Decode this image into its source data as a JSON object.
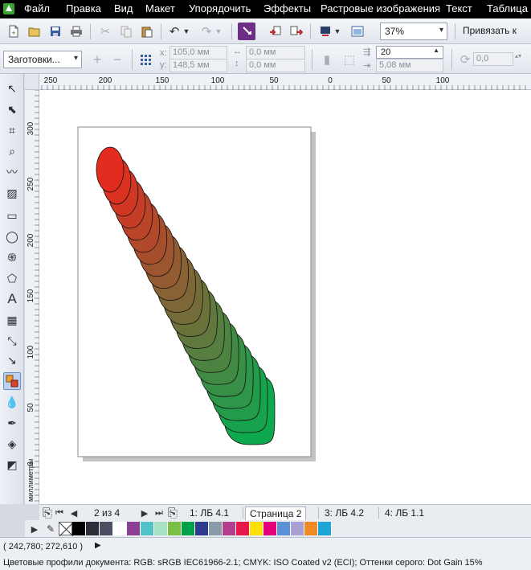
{
  "menu": {
    "items": [
      {
        "label": "Файл",
        "acc": "Ф",
        "rest": "айл"
      },
      {
        "label": "Правка",
        "acc": "П",
        "rest": "равка"
      },
      {
        "label": "Вид",
        "acc": "В",
        "rest": "ид"
      },
      {
        "label": "Макет",
        "acc": "М",
        "rest": "акет"
      },
      {
        "label": "Упорядочить",
        "acc": "У",
        "rest": "порядочить"
      },
      {
        "label": "Эффекты",
        "acc": "Э",
        "rest": "ффекты"
      },
      {
        "label": "Растровые изображения",
        "acc": "Р",
        "rest": "астровые изображения"
      },
      {
        "label": "Текст",
        "acc": "Т",
        "rest": "екст"
      },
      {
        "label": "Таблица",
        "acc": "Т",
        "rest": "аблица"
      }
    ]
  },
  "toolbar": {
    "zoom": "37%",
    "snap_label": "Привязать к"
  },
  "property_bar": {
    "preset": "Заготовки...",
    "x_label": "x:",
    "x_value": "105,0 мм",
    "y_label": "y:",
    "y_value": "148,5 мм",
    "w_value": "0,0 мм",
    "h_value": "0,0 мм",
    "steps": "20",
    "spacing": "5,08 мм",
    "rotation": "0,0"
  },
  "rulers": {
    "h_ticks": [
      "250",
      "200",
      "150",
      "100",
      "50",
      "0",
      "50",
      "100"
    ],
    "v_ticks": [
      "300",
      "250",
      "200",
      "150",
      "100",
      "50",
      "0"
    ],
    "unit": "миллиметры"
  },
  "pages": {
    "counter": "2 из 4",
    "tabs": [
      {
        "label": "1: ЛБ 4.1",
        "active": false
      },
      {
        "label": "Страница 2",
        "active": true
      },
      {
        "label": "3: ЛБ 4.2",
        "active": false
      },
      {
        "label": "4: ЛБ 1.1",
        "active": false
      }
    ]
  },
  "palette": {
    "colors": [
      "#000000",
      "#2b2f3a",
      "#4c4f63",
      "#ffffff",
      "#8c3f93",
      "#4fc3c7",
      "#a8e0c3",
      "#7ac043",
      "#00a04a",
      "#2e3a8c",
      "#8a9aa7",
      "#b23e8c",
      "#e6194b",
      "#ffe000",
      "#e4007c",
      "#5b8fd6",
      "#a89fd4",
      "#f08a24",
      "#1ea5d8"
    ]
  },
  "status": {
    "coords": "( 242,780; 272,610 )",
    "profile": "Цветовые профили документа: RGB: sRGB IEC61966-2.1; CMYK: ISO Coated v2 (ECI); Оттенки серого: Dot Gain 15%"
  },
  "colors": {
    "blend_start": "#e42b1f",
    "blend_end": "#0ea84f",
    "menubar": "#000000",
    "canvas": "#ffffff"
  }
}
